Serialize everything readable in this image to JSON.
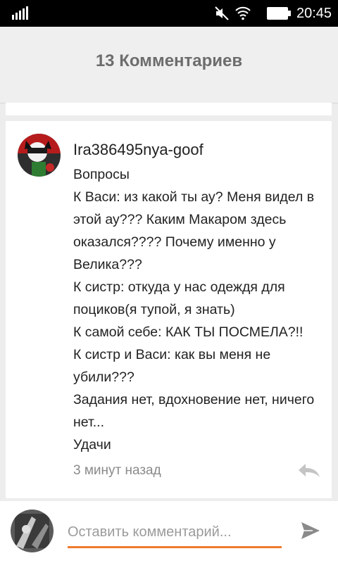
{
  "status_bar": {
    "time": "20:45"
  },
  "header": {
    "title": "13 Комментариев"
  },
  "comment": {
    "author": "Ira386495nya-goof",
    "lines": [
      "Вопросы",
      "К Васи: из какой ты ау? Меня видел в",
      "этой ау??? Каким Макаром здесь",
      "оказался???? Почему именно у",
      "Велика???",
      "К систр: откуда у нас одеждя для",
      "поциков(я тупой, я знать)",
      "К самой себе: КАК ТЫ ПОСМЕЛА?!!",
      "К систр и Васи: как вы меня не",
      "убили???",
      "Задания нет, вдохновение нет, ничего",
      "нет...",
      "Удачи"
    ],
    "timestamp": "3 минут назад"
  },
  "input": {
    "placeholder": "Оставить комментарий..."
  },
  "colors": {
    "accent": "#f07a2e",
    "header_bg": "#efefef",
    "page_bg": "#ededed"
  }
}
